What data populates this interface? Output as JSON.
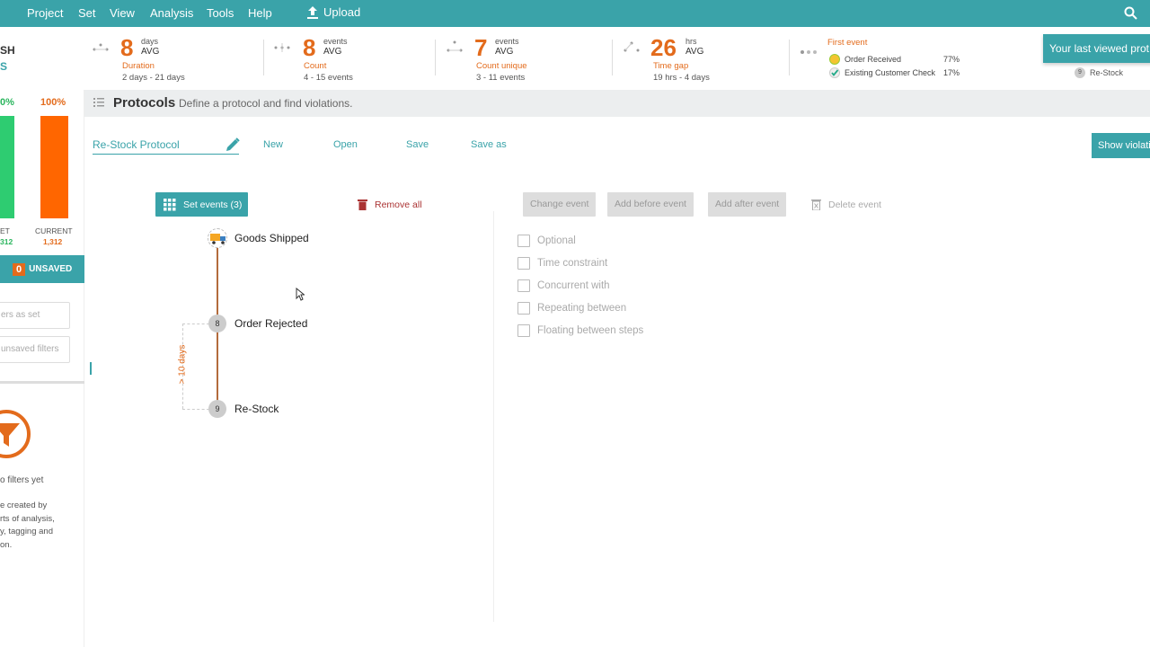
{
  "menu": {
    "items": [
      "Project",
      "Set",
      "View",
      "Analysis",
      "Tools",
      "Help"
    ],
    "upload": "Upload"
  },
  "stats": {
    "duration": {
      "value": "8",
      "unit": "days",
      "avg": "AVG",
      "label": "Duration",
      "range": "2 days - 21 days"
    },
    "count": {
      "value": "8",
      "unit": "events",
      "avg": "AVG",
      "label": "Count",
      "range": "4 - 15 events"
    },
    "count_unique": {
      "value": "7",
      "unit": "events",
      "avg": "AVG",
      "label": "Count unique",
      "range": "3 - 11 events"
    },
    "time_gap": {
      "value": "26",
      "unit": "hrs",
      "avg": "AVG",
      "label": "Time gap",
      "range": "19 hrs - 4 days"
    }
  },
  "first_event": {
    "title": "First event",
    "rows": [
      {
        "name": "Order Received",
        "pct": "77%"
      },
      {
        "name": "Existing Customer Check",
        "pct": "17%"
      }
    ]
  },
  "toast": {
    "text": "Your last viewed prot",
    "last_item": "Re-Stock",
    "last_num": "9"
  },
  "left": {
    "title_partial": "SH",
    "sub_partial": "S",
    "pct_set": "0%",
    "pct_current": "100%",
    "lbl_set": "ET",
    "val_set": "312",
    "lbl_current": "CURRENT",
    "val_current": "1,312",
    "unsaved_count": "0",
    "unsaved_label": "UNSAVED",
    "input1": "ers as set",
    "input2": "unsaved filters",
    "no_filters": "o filters yet",
    "desc": [
      "e created by",
      "rts of analysis,",
      "y, tagging and",
      "on."
    ]
  },
  "protocols": {
    "title": "Protocols",
    "subtitle": "Define a protocol and find violations.",
    "name": "Re-Stock Protocol",
    "new": "New",
    "open": "Open",
    "save": "Save",
    "save_as": "Save as",
    "show_violations": "Show violati"
  },
  "events_panel": {
    "set_events": "Set events (3)",
    "remove_all": "Remove all",
    "events": [
      {
        "num": "",
        "name": "Goods Shipped"
      },
      {
        "num": "8",
        "name": "Order Rejected"
      },
      {
        "num": "9",
        "name": "Re-Stock"
      }
    ],
    "gap_label": "> 10 days"
  },
  "actions": {
    "change": "Change event",
    "add_before": "Add before event",
    "add_after": "Add after event",
    "delete": "Delete event"
  },
  "options": [
    "Optional",
    "Time constraint",
    "Concurrent with",
    "Repeating between",
    "Floating between steps"
  ],
  "colors": {
    "teal": "#3aa3a9",
    "orange": "#e36b1c",
    "green": "#2ecc71"
  }
}
